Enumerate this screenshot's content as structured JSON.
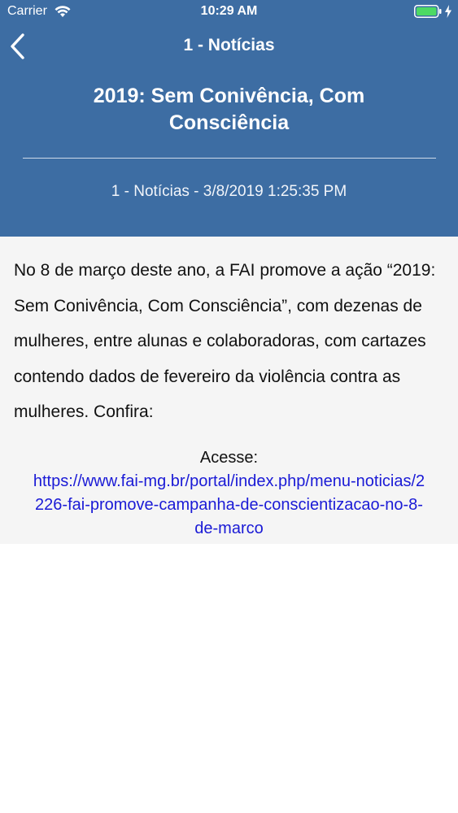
{
  "status_bar": {
    "carrier": "Carrier",
    "time": "10:29 AM",
    "icons": [
      "wifi-icon",
      "battery-icon",
      "charging-bolt-icon"
    ],
    "battery_color": "#4cd964"
  },
  "nav": {
    "back_icon": "chevron-left-icon",
    "title": "1 - Notícias"
  },
  "article": {
    "title": "2019: Sem Conivência, Com Consciência",
    "meta": "1 - Notícias - 3/8/2019 1:25:35 PM",
    "body": "No 8 de março deste ano, a FAI promove a ação “2019: Sem Conivência, Com Consciência”, com dezenas de mulheres, entre alunas e colaboradoras, com cartazes contendo dados de fevereiro da violência contra as mulheres. Confira:",
    "link_label": "Acesse:",
    "link_url": "https://www.fai-mg.br/portal/index.php/menu-noticias/2226-fai-promove-campanha-de-conscientizacao-no-8-de-marco"
  },
  "colors": {
    "header_bg": "#3d6da3",
    "content_bg": "#f5f5f5",
    "link": "#1a1ad6"
  }
}
